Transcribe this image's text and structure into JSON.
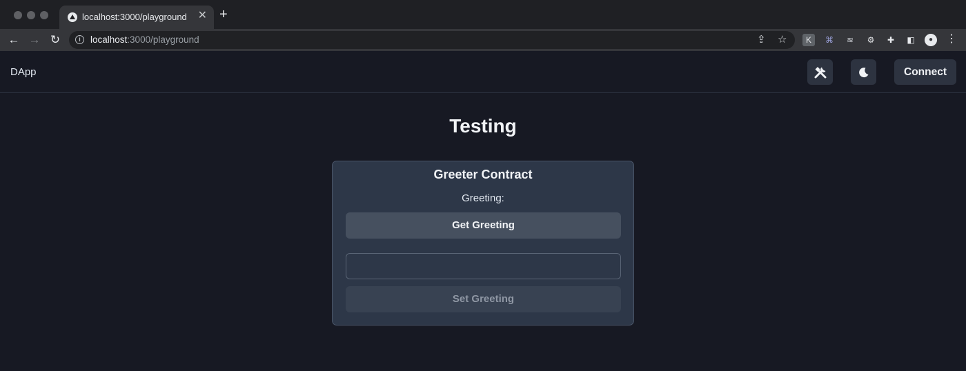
{
  "browser": {
    "tab_title": "localhost:3000/playground",
    "tab_close": "✕",
    "new_tab": "+",
    "url_host": "localhost",
    "url_rest": ":3000/playground",
    "nav": {
      "back": "←",
      "forward": "→",
      "reload": "↻"
    },
    "omnibox_icons": {
      "share": "⇪",
      "star": "☆"
    },
    "extensions": [
      "K",
      "⌘",
      "≋",
      "⚙",
      "✚",
      "◧",
      "●"
    ]
  },
  "app": {
    "brand": "DApp",
    "connect_label": "Connect",
    "page_title": "Testing",
    "card": {
      "title": "Greeter Contract",
      "greeting_label": "Greeting:",
      "get_button": "Get Greeting",
      "input_value": "",
      "set_button": "Set Greeting"
    }
  },
  "icons": {
    "tools": "tools-icon",
    "theme": "moon-icon"
  },
  "colors": {
    "app_bg": "#171923",
    "card_bg": "#2d3748",
    "button_bg": "#2d3340",
    "text": "#f1f3f6"
  }
}
